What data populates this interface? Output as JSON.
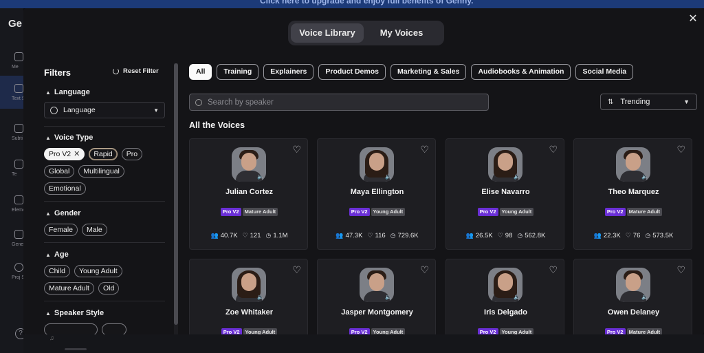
{
  "banner": {
    "text": "Click here to upgrade and enjoy full benefits of Genny."
  },
  "app": {
    "brand": "Ge",
    "nav": [
      {
        "label": "Me",
        "icon": "cloud-icon"
      },
      {
        "label": "Text Spe",
        "icon": "speech-icon"
      },
      {
        "label": "Subti",
        "icon": "subtitles-icon"
      },
      {
        "label": "Te",
        "icon": "text-icon"
      },
      {
        "label": "Eleme",
        "icon": "elements-icon"
      },
      {
        "label": "Gene",
        "icon": "generate-icon"
      },
      {
        "label": "Proj Setti",
        "icon": "settings-icon"
      }
    ],
    "help": "?"
  },
  "modal": {
    "close": "✕",
    "tabs": [
      {
        "label": "Voice Library",
        "active": true
      },
      {
        "label": "My Voices",
        "active": false
      }
    ]
  },
  "filters": {
    "title": "Filters",
    "reset_label": "Reset Filter",
    "language": {
      "heading": "Language",
      "select_value": "Language"
    },
    "voice_type": {
      "heading": "Voice Type",
      "options": [
        {
          "label": "Pro V2",
          "selected": true
        },
        {
          "label": "Rapid",
          "selected": false
        },
        {
          "label": "Pro",
          "selected": false
        },
        {
          "label": "Global",
          "selected": false
        },
        {
          "label": "Multilingual",
          "selected": false
        },
        {
          "label": "Emotional",
          "selected": false
        }
      ]
    },
    "gender": {
      "heading": "Gender",
      "options": [
        "Female",
        "Male"
      ]
    },
    "age": {
      "heading": "Age",
      "options": [
        "Child",
        "Young Adult",
        "Mature Adult",
        "Old"
      ]
    },
    "speaker_style": {
      "heading": "Speaker Style"
    }
  },
  "categories": [
    "All",
    "Training",
    "Explainers",
    "Product Demos",
    "Marketing & Sales",
    "Audiobooks & Animation",
    "Social Media"
  ],
  "active_category": "All",
  "search": {
    "placeholder": "Search by speaker",
    "value": ""
  },
  "sort": {
    "value": "Trending"
  },
  "section_title": "All the Voices",
  "voices": [
    {
      "name": "Julian Cortez",
      "tier": "Pro V2",
      "age": "Mature Adult",
      "uses": "40.7K",
      "likes": "121",
      "plays": "1.1M",
      "gender": "male"
    },
    {
      "name": "Maya Ellington",
      "tier": "Pro V2",
      "age": "Young Adult",
      "uses": "47.3K",
      "likes": "116",
      "plays": "729.6K",
      "gender": "female"
    },
    {
      "name": "Elise Navarro",
      "tier": "Pro V2",
      "age": "Young Adult",
      "uses": "26.5K",
      "likes": "98",
      "plays": "562.8K",
      "gender": "female"
    },
    {
      "name": "Theo Marquez",
      "tier": "Pro V2",
      "age": "Mature Adult",
      "uses": "22.3K",
      "likes": "76",
      "plays": "573.5K",
      "gender": "male"
    },
    {
      "name": "Zoe Whitaker",
      "tier": "Pro V2",
      "age": "Young Adult",
      "gender": "female"
    },
    {
      "name": "Jasper Montgomery",
      "tier": "Pro V2",
      "age": "Young Adult",
      "gender": "male"
    },
    {
      "name": "Iris Delgado",
      "tier": "Pro V2",
      "age": "Young Adult",
      "gender": "female"
    },
    {
      "name": "Owen Delaney",
      "tier": "Pro V2",
      "age": "Mature Adult",
      "gender": "male"
    }
  ]
}
